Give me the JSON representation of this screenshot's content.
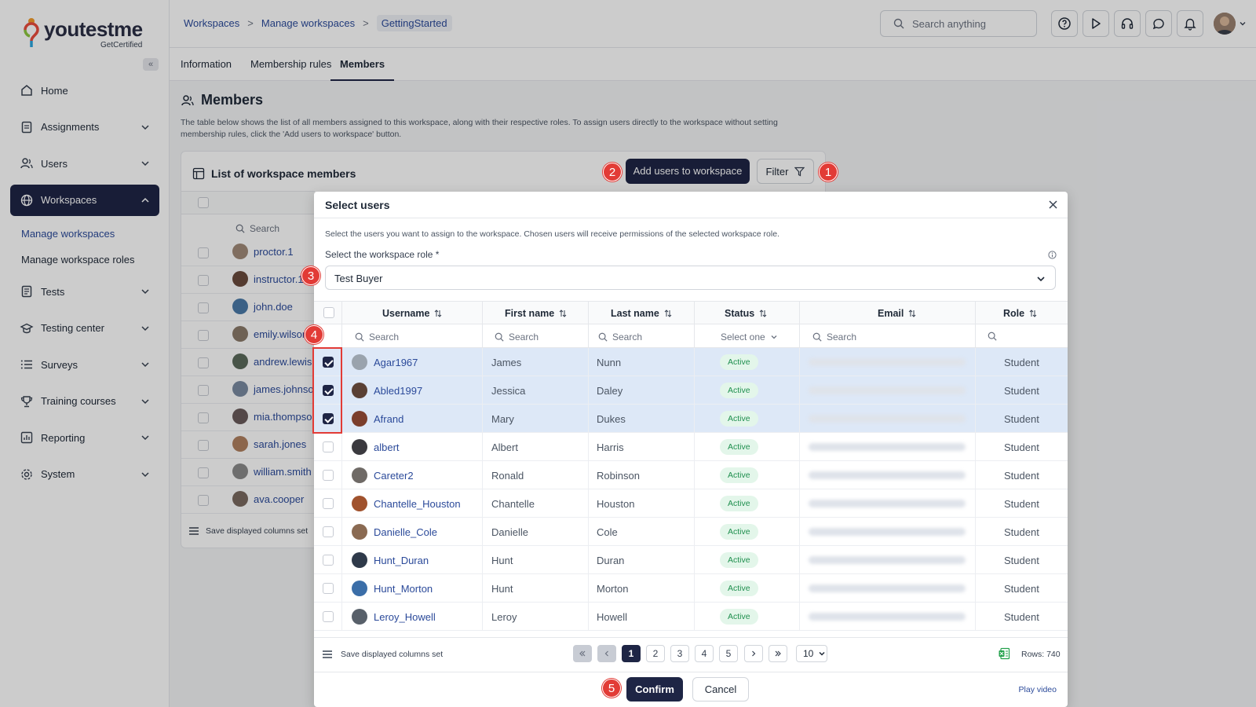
{
  "brand": {
    "name": "youtestme",
    "tagline": "GetCertified"
  },
  "sidebar": {
    "collapse_label": "«",
    "items": [
      {
        "label": "Home",
        "icon": "home-icon",
        "expandable": false
      },
      {
        "label": "Assignments",
        "icon": "assignments-icon",
        "expandable": true
      },
      {
        "label": "Users",
        "icon": "users-icon",
        "expandable": true
      },
      {
        "label": "Workspaces",
        "icon": "globe-icon",
        "expandable": true,
        "active": true
      },
      {
        "label": "Tests",
        "icon": "tests-icon",
        "expandable": true
      },
      {
        "label": "Testing center",
        "icon": "testing-center-icon",
        "expandable": true
      },
      {
        "label": "Surveys",
        "icon": "list-icon",
        "expandable": true
      },
      {
        "label": "Training courses",
        "icon": "trophy-icon",
        "expandable": true
      },
      {
        "label": "Reporting",
        "icon": "reporting-icon",
        "expandable": true
      },
      {
        "label": "System",
        "icon": "gear-icon",
        "expandable": true
      }
    ],
    "sub_items": [
      {
        "label": "Manage workspaces",
        "current": true
      },
      {
        "label": "Manage workspace roles",
        "current": false
      }
    ]
  },
  "topbar": {
    "breadcrumb": [
      "Workspaces",
      "Manage workspaces",
      "GettingStarted"
    ],
    "breadcrumb_sep": ">",
    "search_placeholder": "Search anything",
    "icons": [
      "help-icon",
      "play-icon",
      "headset-icon",
      "chat-icon",
      "bell-icon"
    ]
  },
  "tabs": [
    {
      "label": "Information",
      "active": false
    },
    {
      "label": "Membership rules",
      "active": false
    },
    {
      "label": "Members",
      "active": true
    }
  ],
  "page": {
    "title": "Members",
    "description": "The table below shows the list of all members assigned to this workspace, along with their respective roles. To assign users directly to the workspace without setting membership rules, click the 'Add users to workspace' button."
  },
  "members_card": {
    "title": "List of workspace members",
    "add_users_label": "Add users to workspace",
    "filter_label": "Filter",
    "search_placeholder": "Search",
    "members": [
      "proctor.1",
      "instructor.1",
      "john.doe",
      "emily.wilson",
      "andrew.lewis",
      "james.johnson",
      "mia.thompson",
      "sarah.jones",
      "william.smith",
      "ava.cooper"
    ],
    "save_columns_label": "Save displayed columns set"
  },
  "modal": {
    "title": "Select users",
    "description": "Select the users you want to assign to the workspace. Chosen users will receive permissions of the selected workspace role.",
    "role_label": "Select the workspace role *",
    "role_value": "Test Buyer",
    "columns": [
      "Username",
      "First name",
      "Last name",
      "Status",
      "Email",
      "Role"
    ],
    "filters": {
      "username": "Search",
      "first_name": "Search",
      "last_name": "Search",
      "status": "Select one",
      "email": "Search"
    },
    "rows": [
      {
        "username": "Agar1967",
        "first_name": "James",
        "last_name": "Nunn",
        "status": "Active",
        "role": "Student",
        "selected": true,
        "avatar_color": "#9aa3ad"
      },
      {
        "username": "Abled1997",
        "first_name": "Jessica",
        "last_name": "Daley",
        "status": "Active",
        "role": "Student",
        "selected": true,
        "avatar_color": "#5a4034"
      },
      {
        "username": "Afrand",
        "first_name": "Mary",
        "last_name": "Dukes",
        "status": "Active",
        "role": "Student",
        "selected": true,
        "avatar_color": "#7b3e2c"
      },
      {
        "username": "albert",
        "first_name": "Albert",
        "last_name": "Harris",
        "status": "Active",
        "role": "Student",
        "selected": false,
        "avatar_color": "#3b3a3f"
      },
      {
        "username": "Careter2",
        "first_name": "Ronald",
        "last_name": "Robinson",
        "status": "Active",
        "role": "Student",
        "selected": false,
        "avatar_color": "#6f6a66"
      },
      {
        "username": "Chantelle_Houston",
        "first_name": "Chantelle",
        "last_name": "Houston",
        "status": "Active",
        "role": "Student",
        "selected": false,
        "avatar_color": "#a0522d"
      },
      {
        "username": "Danielle_Cole",
        "first_name": "Danielle",
        "last_name": "Cole",
        "status": "Active",
        "role": "Student",
        "selected": false,
        "avatar_color": "#8a6a52"
      },
      {
        "username": "Hunt_Duran",
        "first_name": "Hunt",
        "last_name": "Duran",
        "status": "Active",
        "role": "Student",
        "selected": false,
        "avatar_color": "#2f3a4a"
      },
      {
        "username": "Hunt_Morton",
        "first_name": "Hunt",
        "last_name": "Morton",
        "status": "Active",
        "role": "Student",
        "selected": false,
        "avatar_color": "#3b6ea8"
      },
      {
        "username": "Leroy_Howell",
        "first_name": "Leroy",
        "last_name": "Howell",
        "status": "Active",
        "role": "Student",
        "selected": false,
        "avatar_color": "#58606a"
      }
    ],
    "pagination": {
      "pages": [
        "1",
        "2",
        "3",
        "4",
        "5"
      ],
      "current": "1",
      "page_size": "10"
    },
    "rows_count": "Rows: 740",
    "save_columns_label": "Save displayed columns set",
    "confirm_label": "Confirm",
    "cancel_label": "Cancel",
    "play_video_label": "Play video"
  },
  "markers": [
    "1",
    "2",
    "3",
    "4",
    "5"
  ],
  "colors": {
    "primary": "#1e2545",
    "link": "#2b4a9a",
    "marker": "#e23b36",
    "active_badge_bg": "#e3f6ea",
    "active_badge_text": "#1f8f4e",
    "selected_row": "#dde8f7"
  }
}
